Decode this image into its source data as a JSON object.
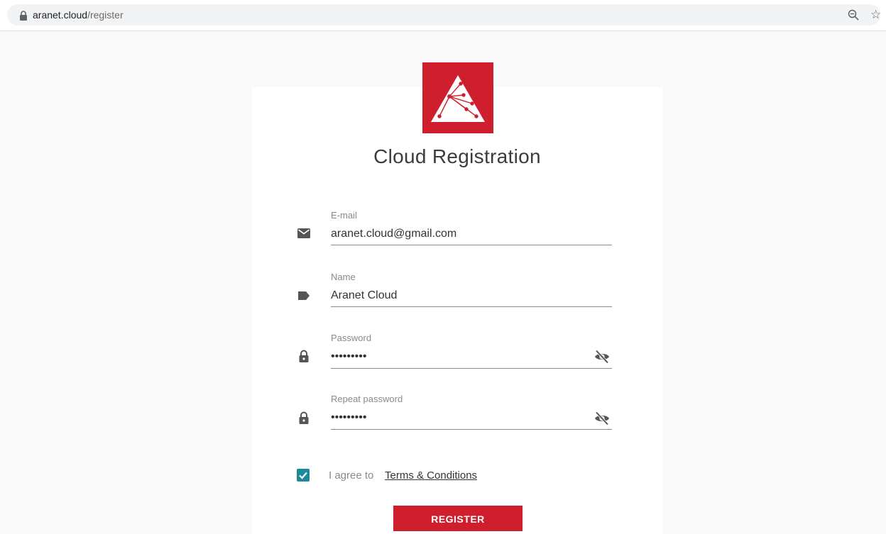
{
  "browser": {
    "url_host": "aranet.cloud",
    "url_path": "/register",
    "icons": [
      "lock-icon",
      "zoom-icon",
      "bookmark-star-icon"
    ]
  },
  "page": {
    "title": "Cloud Registration",
    "brand_color": "#cf1e2e",
    "accent_color": "#1d8a99"
  },
  "form": {
    "email": {
      "label": "E-mail",
      "value": "aranet.cloud@gmail.com",
      "icon": "mail-icon"
    },
    "name": {
      "label": "Name",
      "value": "Aranet Cloud",
      "icon": "label-icon"
    },
    "password": {
      "label": "Password",
      "value": "•••••••••",
      "icon": "lock-icon",
      "toggle_icon": "visibility-off-icon"
    },
    "repeat_password": {
      "label": "Repeat password",
      "value": "•••••••••",
      "icon": "lock-icon",
      "toggle_icon": "visibility-off-icon"
    },
    "agree": {
      "checked": true,
      "text": "I agree to",
      "link": "Terms & Conditions"
    },
    "submit_label": "REGISTER"
  }
}
